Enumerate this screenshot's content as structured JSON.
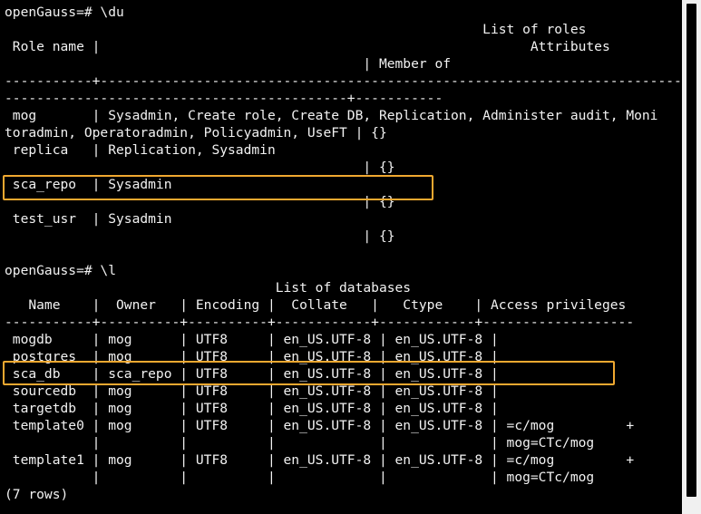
{
  "terminal": {
    "lines": [
      "openGauss=# \\du",
      "                                                            List of roles",
      " Role name |                                                      Attributes",
      "                                             | Member of",
      "-----------+------------------------------------------------------------------------------",
      "-------------------------------------------+-----------",
      " mog       | Sysadmin, Create role, Create DB, Replication, Administer audit, Moni",
      "toradmin, Operatoradmin, Policyadmin, UseFT | {}",
      " replica   | Replication, Sysadmin",
      "                                             | {}",
      " sca_repo  | Sysadmin",
      "                                             | {}",
      " test_usr  | Sysadmin",
      "                                             | {}",
      "",
      "openGauss=# \\l",
      "                                  List of databases",
      "   Name    |  Owner   | Encoding |  Collate   |   Ctype    | Access privileges",
      "-----------+----------+----------+------------+------------+-------------------",
      " mogdb     | mog      | UTF8     | en_US.UTF-8 | en_US.UTF-8 |",
      " postgres  | mog      | UTF8     | en_US.UTF-8 | en_US.UTF-8 |",
      " sca_db    | sca_repo | UTF8     | en_US.UTF-8 | en_US.UTF-8 |",
      " sourcedb  | mog      | UTF8     | en_US.UTF-8 | en_US.UTF-8 |",
      " targetdb  | mog      | UTF8     | en_US.UTF-8 | en_US.UTF-8 |",
      " template0 | mog      | UTF8     | en_US.UTF-8 | en_US.UTF-8 | =c/mog         +",
      "           |          |          |             |             | mog=CTc/mog",
      " template1 | mog      | UTF8     | en_US.UTF-8 | en_US.UTF-8 | =c/mog         +",
      "           |          |          |             |             | mog=CTc/mog",
      "(7 rows)"
    ]
  },
  "colors": {
    "background": "#000000",
    "text": "#f2f2f2",
    "highlight": "#f0a830",
    "scrollbar_track": "#f0f0f0",
    "scrollbar_thumb": "#000000"
  }
}
